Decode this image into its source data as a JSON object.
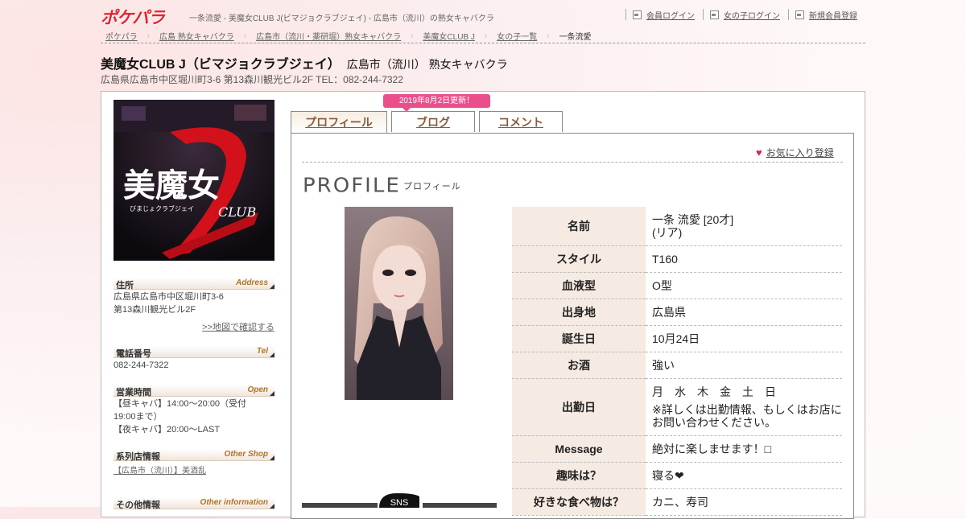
{
  "header": {
    "logo_text": "ポケパラ",
    "tagline": "一条流愛 - 美魔女CLUB J(ビマジョクラブジェイ) - 広島市（流川）の熟女キャバクラ",
    "links": [
      {
        "label": "会員ログイン",
        "icon": "login-icon"
      },
      {
        "label": "女の子ログイン",
        "icon": "login-icon"
      },
      {
        "label": "新規会員登録",
        "icon": "login-icon"
      }
    ]
  },
  "breadcrumb": [
    "ポケパラ",
    "広島 熟女キャバクラ",
    "広島市（流川・薬研堀）熟女キャバクラ",
    "美魔女CLUB J",
    "女の子一覧",
    "一条流愛"
  ],
  "shop": {
    "name": "美魔女CLUB J（ビマジョクラブジェイ）",
    "category": "広島市（流川） 熟女キャバクラ",
    "address_line": "広島県広島市中区堀川町3-6 第13森川観光ビル2F TEL：082-244-7322",
    "logo_main": "美魔女",
    "logo_sub": "びまじょクラブジェイ",
    "logo_club": "CLUB"
  },
  "sidebar": {
    "address": {
      "label": "住所",
      "label_en": "Address",
      "line1": "広島県広島市中区堀川町3-6",
      "line2": "第13森川観光ビル2F",
      "map_link": ">>地図で確認する"
    },
    "tel": {
      "label": "電話番号",
      "label_en": "Tel",
      "value": "082-244-7322"
    },
    "hours": {
      "label": "営業時間",
      "label_en": "Open",
      "line1": "【昼キャバ】14:00～20:00（受付",
      "line2": "19:00まで）",
      "line3": "【夜キャバ】20:00～LAST"
    },
    "other_shop": {
      "label": "系列店情報",
      "label_en": "Other Shop",
      "link": "【広島市（流川）】美酒乱"
    },
    "other_info": {
      "label": "その他情報",
      "label_en": "Other information"
    }
  },
  "tabs": {
    "update_badge": "2019年8月2日更新！",
    "items": [
      "プロフィール",
      "ブログ",
      "コメント"
    ],
    "active": 0
  },
  "favorite_label": "お気に入り登録",
  "profile": {
    "title_en": "PROFILE",
    "title_ja": "プロフィール",
    "sns_label": "SNS",
    "rows": [
      {
        "key": "名前",
        "value": "一条 流愛 [20才]",
        "value2": "(リア)"
      },
      {
        "key": "スタイル",
        "value": "T160"
      },
      {
        "key": "血液型",
        "value": "O型"
      },
      {
        "key": "出身地",
        "value": "広島県"
      },
      {
        "key": "誕生日",
        "value": "10月24日"
      },
      {
        "key": "お酒",
        "value": "強い"
      },
      {
        "key": "出勤日",
        "value": "月　水　木　金　土　日",
        "value2": "※詳しくは出勤情報、もしくはお店にお問い合わせください。"
      },
      {
        "key": "Message",
        "value": "絶対に楽しませます！□"
      },
      {
        "key": "趣味は？",
        "value": "寝る❤"
      },
      {
        "key": "好きな食べ物は？",
        "value": "カニ、寿司"
      }
    ]
  },
  "colors": {
    "brand_red": "#e8222d",
    "accent_pink": "#ea4f8c",
    "tab_text": "#8b5a3a",
    "table_key_bg": "#f5ebe2"
  }
}
